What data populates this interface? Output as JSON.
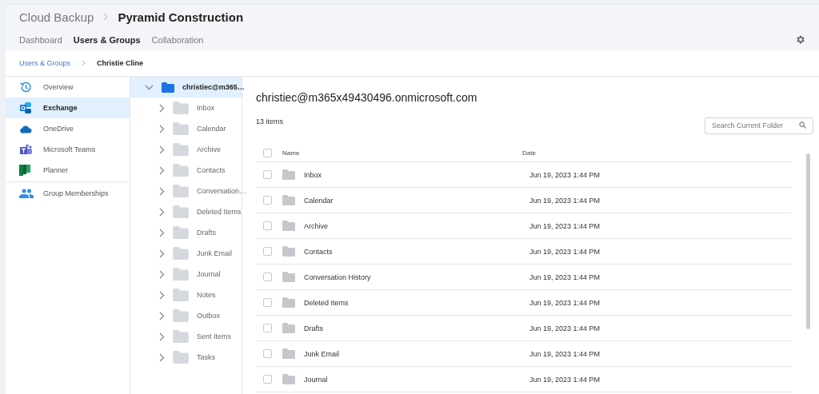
{
  "header": {
    "breadcrumb": [
      "Cloud Backup",
      "Pyramid Construction"
    ],
    "tabs": [
      {
        "label": "Dashboard",
        "selected": false
      },
      {
        "label": "Users & Groups",
        "selected": true
      },
      {
        "label": "Collaboration",
        "selected": false
      }
    ]
  },
  "breadcrumb": [
    "Users & Groups",
    "Christie Cline"
  ],
  "sidebar": {
    "items": [
      {
        "label": "Overview",
        "kind": "overview",
        "selected": false
      },
      {
        "label": "Exchange",
        "kind": "exchange",
        "selected": true
      },
      {
        "label": "OneDrive",
        "kind": "onedrive",
        "selected": false
      },
      {
        "label": "Microsoft Teams",
        "kind": "teams",
        "selected": false
      },
      {
        "label": "Planner",
        "kind": "planner",
        "selected": false
      },
      {
        "label": "Group Memberships",
        "kind": "groups",
        "selected": false
      }
    ]
  },
  "tree": {
    "label": "christiec@m365…",
    "expanded": true,
    "selected": true,
    "children": [
      {
        "label": "Inbox",
        "expanded": false
      },
      {
        "label": "Calendar",
        "expanded": false
      },
      {
        "label": "Archive",
        "expanded": false
      },
      {
        "label": "Contacts",
        "expanded": false
      },
      {
        "label": "Conversation…",
        "expanded": false
      },
      {
        "label": "Deleted Items",
        "expanded": false
      },
      {
        "label": "Drafts",
        "expanded": false
      },
      {
        "label": "Junk Email",
        "expanded": false
      },
      {
        "label": "Journal",
        "expanded": false
      },
      {
        "label": "Notes",
        "expanded": false
      },
      {
        "label": "Outbox",
        "expanded": false
      },
      {
        "label": "Sent Items",
        "expanded": false
      },
      {
        "label": "Tasks",
        "expanded": false
      }
    ]
  },
  "main": {
    "title": "christiec@m365x49430496.onmicrosoft.com",
    "count": "13 items",
    "search": {
      "placeholder": "Search Current Folder"
    },
    "table": {
      "columns": [
        "Name",
        "Date"
      ],
      "all_checked": false,
      "rows": [
        {
          "name": "Inbox",
          "date": "Jun 19, 2023 1:44 PM",
          "checked": false
        },
        {
          "name": "Calendar",
          "date": "Jun 19, 2023 1:44 PM",
          "checked": false
        },
        {
          "name": "Archive",
          "date": "Jun 19, 2023 1:44 PM",
          "checked": false
        },
        {
          "name": "Contacts",
          "date": "Jun 19, 2023 1:44 PM",
          "checked": false
        },
        {
          "name": "Conversation History",
          "date": "Jun 19, 2023 1:44 PM",
          "checked": false
        },
        {
          "name": "Deleted Items",
          "date": "Jun 19, 2023 1:44 PM",
          "checked": false
        },
        {
          "name": "Drafts",
          "date": "Jun 19, 2023 1:44 PM",
          "checked": false
        },
        {
          "name": "Junk Email",
          "date": "Jun 19, 2023 1:44 PM",
          "checked": false
        },
        {
          "name": "Journal",
          "date": "Jun 19, 2023 1:44 PM",
          "checked": false
        }
      ]
    }
  }
}
